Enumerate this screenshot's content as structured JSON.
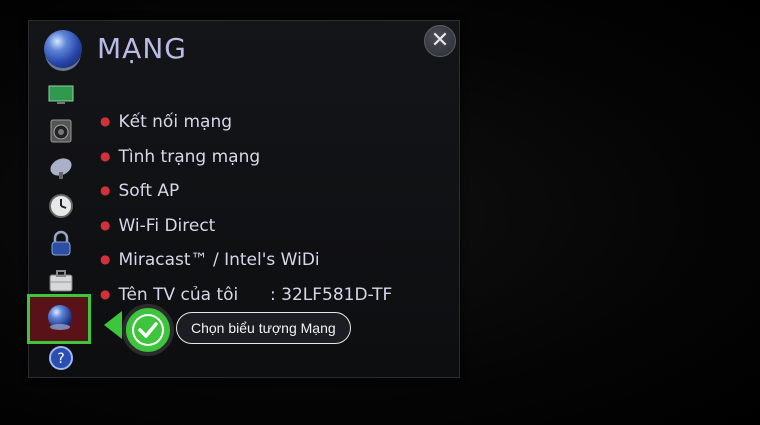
{
  "header": {
    "title": "MẠNG"
  },
  "menu": {
    "items": [
      {
        "label": "Kết nối mạng"
      },
      {
        "label": "Tình trạng mạng"
      },
      {
        "label": "Soft AP"
      },
      {
        "label": "Wi-Fi Direct"
      },
      {
        "label": "Miracast™ / Intel's WiDi"
      },
      {
        "label": "Tên TV của tôi"
      }
    ],
    "tv_name_value": ":  32LF581D-TF"
  },
  "sidebar": {
    "icons": [
      {
        "name": "picture-icon"
      },
      {
        "name": "sound-icon"
      },
      {
        "name": "channel-icon"
      },
      {
        "name": "time-icon"
      },
      {
        "name": "lock-icon"
      },
      {
        "name": "option-icon"
      },
      {
        "name": "network-icon",
        "selected": true
      },
      {
        "name": "help-icon"
      }
    ]
  },
  "callout": {
    "text": "Chọn biểu tượng Mạng"
  },
  "colors": {
    "highlight_border": "#3ec53e",
    "bullet": "#d0313a",
    "title": "#b7bbe6"
  }
}
